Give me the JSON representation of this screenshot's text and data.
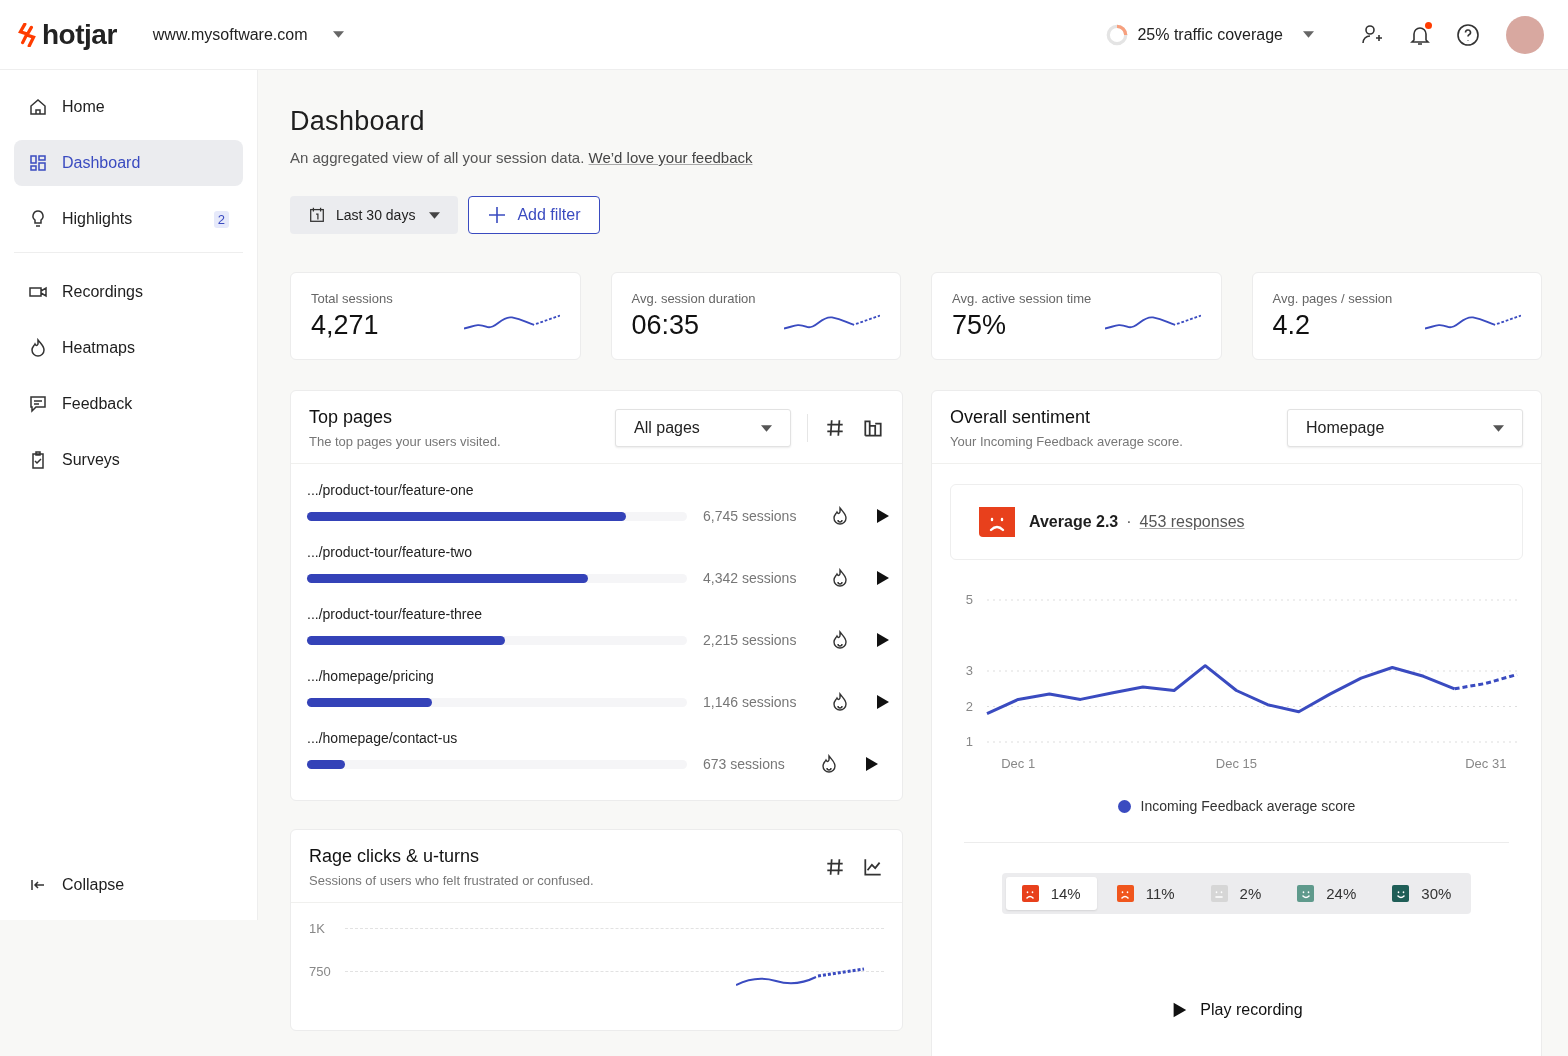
{
  "header": {
    "logo": "hotjar",
    "site": "www.mysoftware.com",
    "coverage": {
      "label": "25% traffic coverage",
      "level": 0.25
    },
    "notifications": {
      "unread": true
    }
  },
  "sidebar": {
    "sections": [
      {
        "items": [
          {
            "label": "Home",
            "selected": false
          },
          {
            "label": "Dashboard",
            "selected": true
          },
          {
            "label": "Highlights",
            "selected": false,
            "badge": "2"
          }
        ]
      },
      {
        "items": [
          {
            "label": "Recordings",
            "selected": false
          },
          {
            "label": "Heatmaps",
            "selected": false
          },
          {
            "label": "Feedback",
            "selected": false
          },
          {
            "label": "Surveys",
            "selected": false
          }
        ]
      }
    ],
    "collapse": "Collapse"
  },
  "page": {
    "title": "Dashboard",
    "subtitle": "An aggregated view of all your session data.",
    "feedback_link": "We’d love your feedback",
    "date_filter": "Last 30 days",
    "add_filter": "Add filter"
  },
  "stats": [
    {
      "label": "Total sessions",
      "value": "4,271"
    },
    {
      "label": "Avg. session duration",
      "value": "06:35"
    },
    {
      "label": "Avg. active session time",
      "value": "75%"
    },
    {
      "label": "Avg. pages / session",
      "value": "4.2"
    }
  ],
  "top_pages": {
    "title": "Top pages",
    "subtitle": "The top pages your users visited.",
    "dropdown": "All pages",
    "rows": [
      {
        "path": ".../product-tour/feature-one",
        "level": 0.84,
        "sessions": "6,745 sessions"
      },
      {
        "path": ".../product-tour/feature-two",
        "level": 0.74,
        "sessions": "4,342 sessions"
      },
      {
        "path": ".../product-tour/feature-three",
        "level": 0.52,
        "sessions": "2,215 sessions"
      },
      {
        "path": ".../homepage/pricing",
        "level": 0.33,
        "sessions": "1,146 sessions"
      },
      {
        "path": ".../homepage/contact-us",
        "level": 0.1,
        "sessions": "673 sessions"
      }
    ]
  },
  "rage_clicks": {
    "title": "Rage clicks & u-turns",
    "subtitle": "Sessions of users who felt frustrated or confused.",
    "axis_labels": [
      "1K",
      "750"
    ]
  },
  "sentiment": {
    "title": "Overall sentiment",
    "subtitle": "Your Incoming Feedback average score.",
    "dropdown": "Homepage",
    "average": "Average 2.3",
    "separator": "·",
    "responses": "453 responses",
    "chart_data": {
      "type": "line",
      "categories": [
        null,
        "Dec 1",
        null,
        null,
        null,
        null,
        null,
        null,
        "Dec 15",
        null,
        null,
        null,
        null,
        null,
        null,
        null,
        "Dec 31",
        null
      ],
      "ylim": [
        1,
        5
      ],
      "yticks": [
        1,
        2,
        3,
        5
      ],
      "series": [
        {
          "name": "Incoming Feedback average score",
          "color": "#3a4bc0",
          "values": [
            1.8,
            2.2,
            2.35,
            2.2,
            2.38,
            2.55,
            2.45,
            3.15,
            2.45,
            2.05,
            1.85,
            2.35,
            2.8,
            3.1,
            2.85,
            2.5,
            2.65,
            2.9
          ]
        }
      ]
    },
    "distribution": [
      {
        "percent": "14%",
        "color": "#e8401c",
        "selected": true
      },
      {
        "percent": "11%",
        "color": "#f0561d",
        "selected": false
      },
      {
        "percent": "2%",
        "color": "#d6d6d6",
        "selected": false
      },
      {
        "percent": "24%",
        "color": "#5f9a8c",
        "selected": false
      },
      {
        "percent": "30%",
        "color": "#1f5e57",
        "selected": false
      }
    ],
    "play": "Play recording"
  }
}
